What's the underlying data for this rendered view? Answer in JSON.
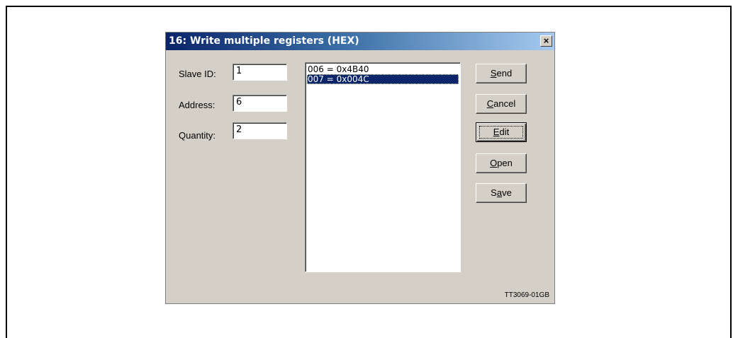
{
  "dialog": {
    "title": "16: Write multiple registers (HEX)",
    "close_symbol": "×"
  },
  "fields": {
    "slave_id": {
      "label": "Slave ID:",
      "value": "1"
    },
    "address": {
      "label": "Address:",
      "value": "6"
    },
    "quantity": {
      "label": "Quantity:",
      "value": "2"
    }
  },
  "registers": [
    {
      "text": "006 = 0x4B40",
      "selected": false
    },
    {
      "text": "007 = 0x004C",
      "selected": true
    }
  ],
  "buttons": {
    "send": {
      "pre": "",
      "key": "S",
      "post": "end"
    },
    "cancel": {
      "pre": "",
      "key": "C",
      "post": "ancel"
    },
    "edit": {
      "pre": "",
      "key": "E",
      "post": "dit"
    },
    "open": {
      "pre": "",
      "key": "O",
      "post": "pen"
    },
    "save": {
      "pre": "S",
      "key": "a",
      "post": "ve"
    }
  },
  "watermark": "TT3069-01GB",
  "colors": {
    "title_bar_start": "#0a246a",
    "title_bar_end": "#a6caf0",
    "dialog_face": "#d4d0c8",
    "selection": "#0a246a"
  }
}
